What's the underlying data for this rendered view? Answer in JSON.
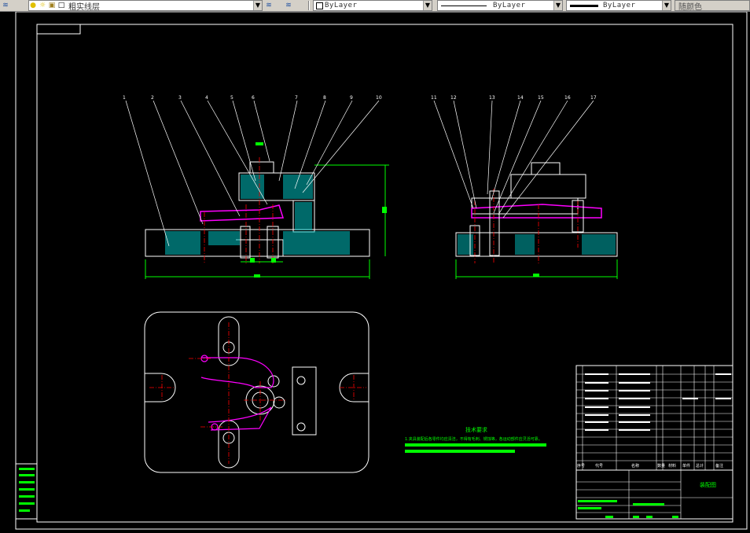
{
  "toolbar": {
    "layer_name": "粗实线层",
    "color_value": "ByLayer",
    "linetype_value": "ByLayer",
    "lineweight_value": "ByLayer",
    "plotstyle_value": "随颜色"
  },
  "drawing": {
    "front_view_labels": [
      "1",
      "2",
      "3",
      "4",
      "5",
      "6",
      "7",
      "8",
      "9",
      "10"
    ],
    "side_view_labels": [
      "11",
      "12",
      "13",
      "14",
      "15",
      "16",
      "17"
    ],
    "tech_title": "技术要求",
    "tech_text": "1.夹具装配后各零件均应清洁，不得有毛刺、锈蚀等，各运动部件应灵活可靠。",
    "title_block_name": "装配图",
    "bom_header": [
      "序号",
      "代号",
      "名称",
      "数量",
      "材料",
      "单件",
      "总计",
      "备注"
    ]
  },
  "colors": {
    "line": "#ffffff",
    "dimension": "#00ff00",
    "hatch": "#00c0c0",
    "center": "#ff0000",
    "hidden": "#ff00ff"
  }
}
